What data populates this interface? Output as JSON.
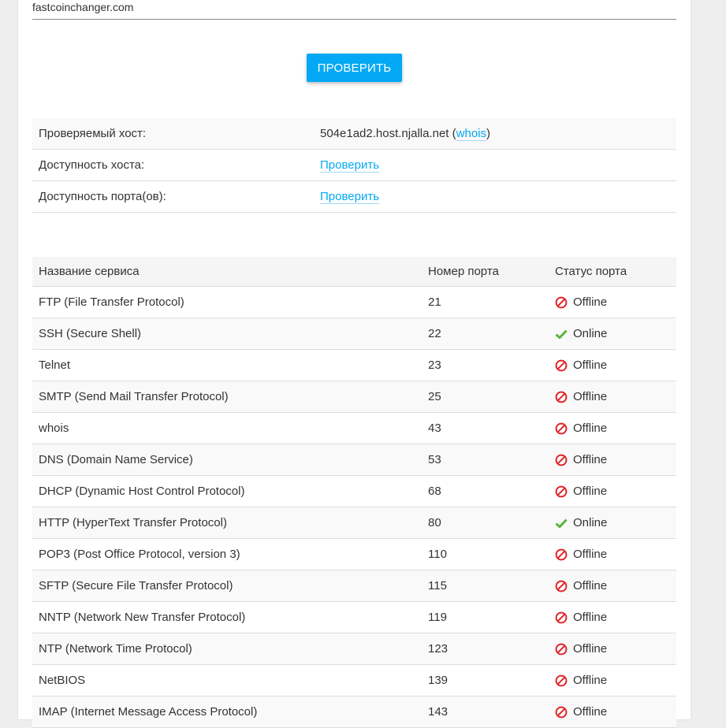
{
  "form": {
    "host_value": "fastcoinchanger.com",
    "submit_label": "ПРОВЕРИТЬ"
  },
  "info": {
    "host_label": "Проверяемый хост:",
    "host_value": "504e1ad2.host.njalla.net",
    "whois_open": "(",
    "whois_label": "whois",
    "whois_close": ")",
    "availability_label": "Доступность хоста:",
    "availability_link": "Проверить",
    "ports_label": "Доступность порта(ов):",
    "ports_link": "Проверить"
  },
  "ports_table": {
    "headers": [
      "Название сервиса",
      "Номер порта",
      "Статус порта"
    ],
    "rows": [
      {
        "name": "FTP (File Transfer Protocol)",
        "port": "21",
        "status": "Offline",
        "icon": "offline-icon"
      },
      {
        "name": "SSH (Secure Shell)",
        "port": "22",
        "status": "Online",
        "icon": "online-icon"
      },
      {
        "name": "Telnet",
        "port": "23",
        "status": "Offline",
        "icon": "offline-icon"
      },
      {
        "name": "SMTP (Send Mail Transfer Protocol)",
        "port": "25",
        "status": "Offline",
        "icon": "offline-icon"
      },
      {
        "name": "whois",
        "port": "43",
        "status": "Offline",
        "icon": "offline-icon"
      },
      {
        "name": "DNS (Domain Name Service)",
        "port": "53",
        "status": "Offline",
        "icon": "offline-icon"
      },
      {
        "name": "DHCP (Dynamic Host Control Protocol)",
        "port": "68",
        "status": "Offline",
        "icon": "offline-icon"
      },
      {
        "name": "HTTP (HyperText Transfer Protocol)",
        "port": "80",
        "status": "Online",
        "icon": "online-icon"
      },
      {
        "name": "POP3 (Post Office Protocol, version 3)",
        "port": "110",
        "status": "Offline",
        "icon": "offline-icon"
      },
      {
        "name": "SFTP (Secure File Transfer Protocol)",
        "port": "115",
        "status": "Offline",
        "icon": "offline-icon"
      },
      {
        "name": "NNTP (Network New Transfer Protocol)",
        "port": "119",
        "status": "Offline",
        "icon": "offline-icon"
      },
      {
        "name": "NTP (Network Time Protocol)",
        "port": "123",
        "status": "Offline",
        "icon": "offline-icon"
      },
      {
        "name": "NetBIOS",
        "port": "139",
        "status": "Offline",
        "icon": "offline-icon"
      },
      {
        "name": "IMAP (Internet Message Access Protocol)",
        "port": "143",
        "status": "Offline",
        "icon": "offline-icon"
      }
    ]
  },
  "colors": {
    "accent": "#03a9f4",
    "offline": "#e0262a",
    "online": "#5cb33c"
  }
}
